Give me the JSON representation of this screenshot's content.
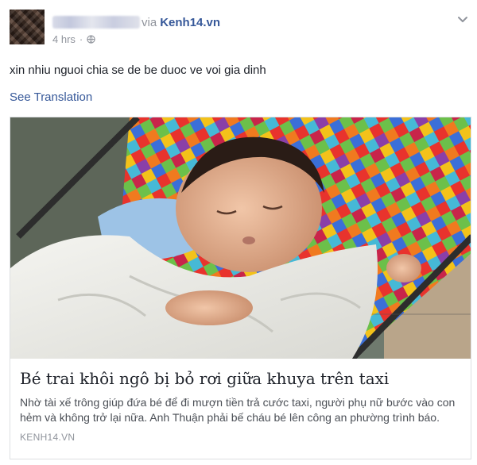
{
  "post": {
    "via_text": "via",
    "source": "Kenh14.vn",
    "time": "4 hrs",
    "separator": "·",
    "privacy_icon": "globe-icon",
    "menu_icon": "chevron-down-icon",
    "message": "xin nhiu nguoi chia se de be duoc ve voi gia dinh",
    "see_translation": "See Translation"
  },
  "link_card": {
    "image_icon": "photo-sleeping-baby",
    "title": "Bé trai khôi ngô bị bỏ rơi giữa khuya trên taxi",
    "description": "Nhờ tài xế trông giúp đứa bé để đi mượn tiền trả cước taxi, người phụ nữ bước vào con hẻm và không trở lại nữa. Anh Thuận phải bế cháu bé lên công an phường trình báo.",
    "domain": "KENH14.VN"
  },
  "colors": {
    "link": "#365899",
    "meta": "#90949c",
    "text": "#1d2129",
    "border": "#dddfe2"
  }
}
